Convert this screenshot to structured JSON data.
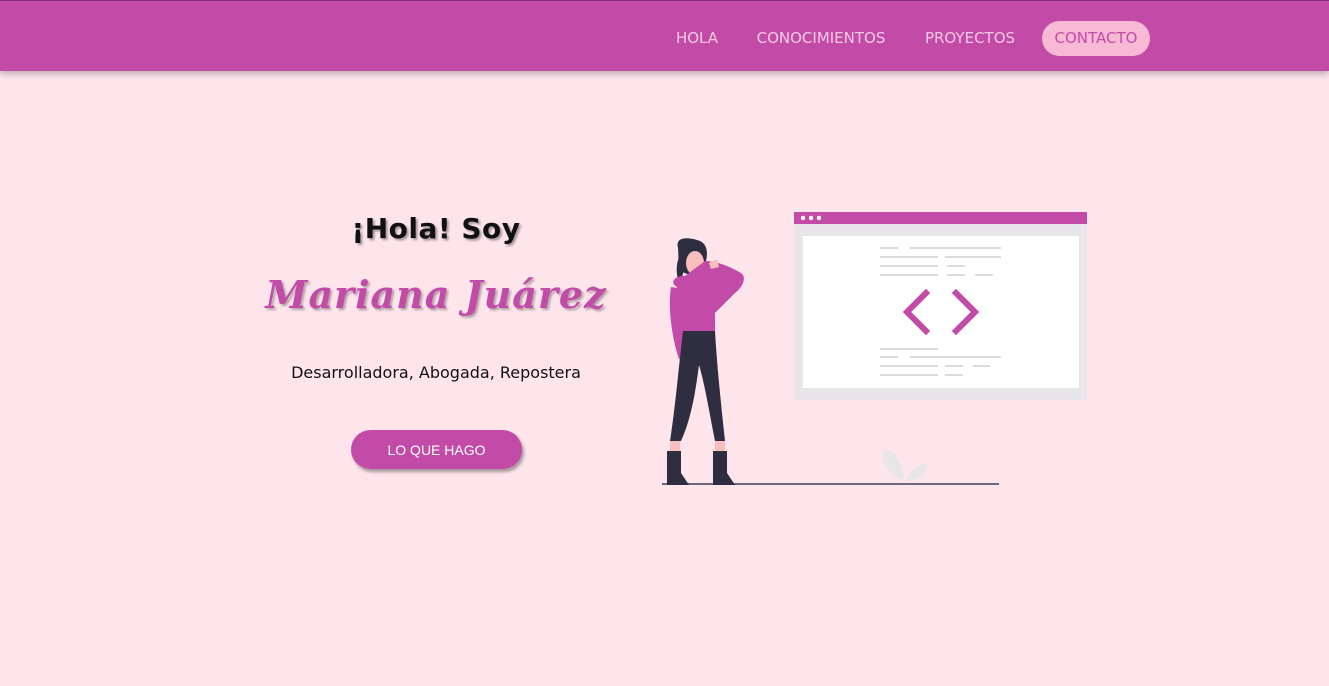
{
  "nav": {
    "items": [
      {
        "label": "HOLA"
      },
      {
        "label": "CONOCIMIENTOS"
      },
      {
        "label": "PROYECTOS"
      },
      {
        "label": "CONTACTO",
        "active": true
      }
    ]
  },
  "hero": {
    "greeting": "¡Hola! Soy",
    "name": "Mariana Juárez",
    "roles": "Desarrolladora, Abogada, Repostera",
    "cta_label": "LO QUE HAGO"
  },
  "illustration": {
    "icon": "code-brackets-icon",
    "code_symbol": "< >"
  },
  "colors": {
    "primary": "#c24ba8",
    "background": "#fee5ec",
    "nav_text": "#f6c9e3",
    "active_pill": "#f7b9d3"
  }
}
